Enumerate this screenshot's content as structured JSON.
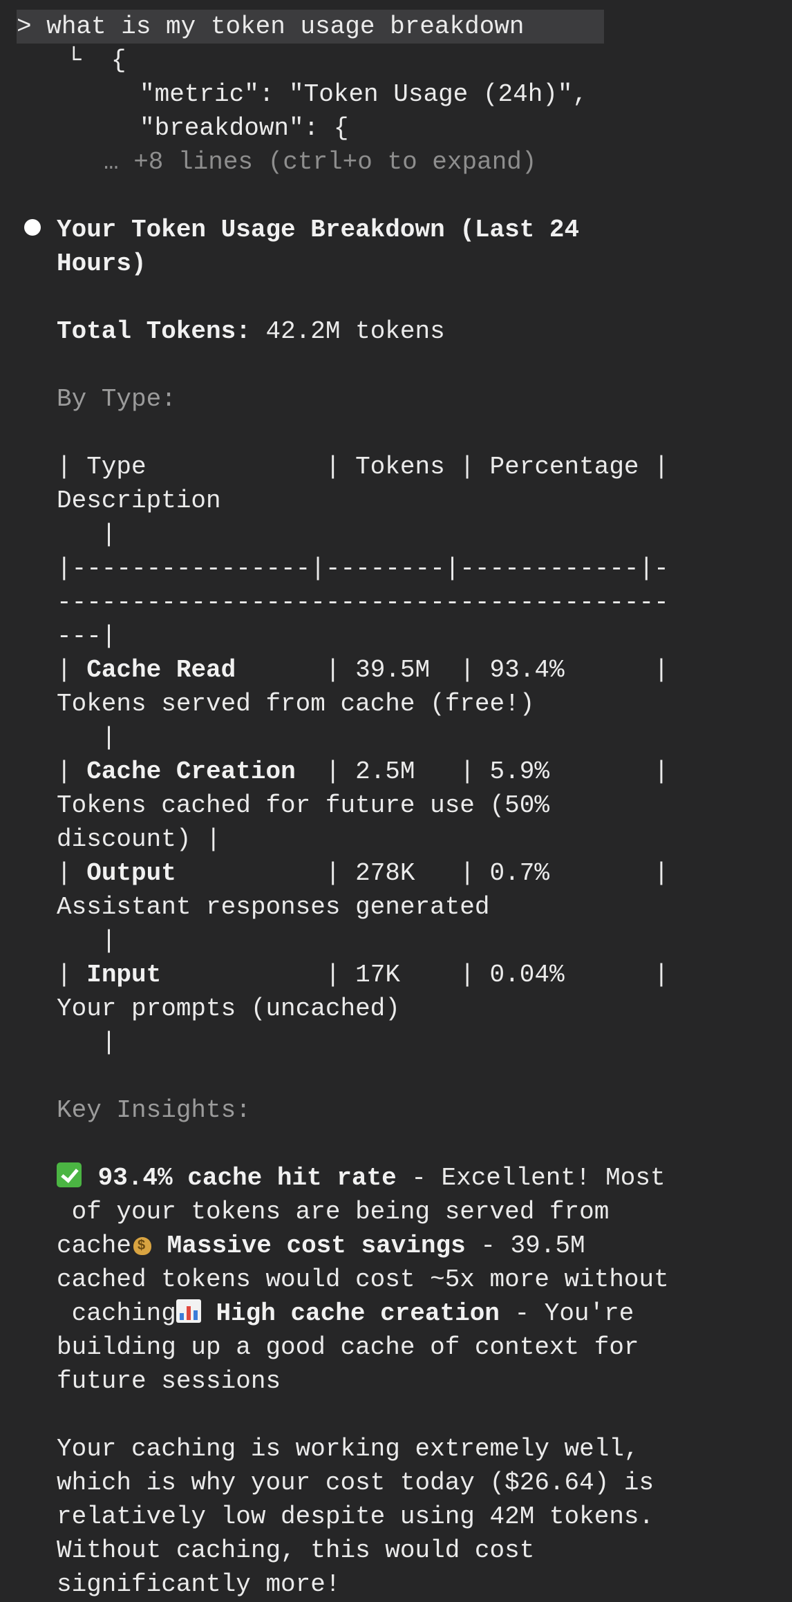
{
  "command": {
    "prompt_symbol": ">",
    "text": "what is my token usage breakdown"
  },
  "tool_output": {
    "corner": "└",
    "lines": [
      "{",
      "\"metric\": \"Token Usage (24h)\",",
      "\"breakdown\": {"
    ],
    "collapsed": "… +8 lines (ctrl+o to expand)"
  },
  "response": {
    "heading_line1": "Your Token Usage Breakdown (Last 24",
    "heading_line2": "Hours)",
    "total_label": "Total Tokens:",
    "total_value": " 42.2M tokens",
    "by_type_label": "By Type:",
    "table": {
      "header_line1": "| Type            | Tokens | Percentage |",
      "header_line2": "Description",
      "header_line3": "   |",
      "sep_line1": "|----------------|--------|------------|-",
      "sep_line2": "-----------------------------------------",
      "sep_line3": "---|",
      "rows": [
        {
          "name": "Cache Read",
          "pad": "     ",
          "rest": " | 39.5M  | 93.4%      |",
          "desc_lines": [
            "Tokens served from cache (free!)",
            "   |"
          ]
        },
        {
          "name": "Cache Creation",
          "pad": " ",
          "rest": " | 2.5M   | 5.9%       |",
          "desc_lines": [
            "Tokens cached for future use (50%",
            "discount) |"
          ]
        },
        {
          "name": "Output",
          "pad": "         ",
          "rest": " | 278K   | 0.7%       |",
          "desc_lines": [
            "Assistant responses generated",
            "   |"
          ]
        },
        {
          "name": "Input",
          "pad": "          ",
          "rest": " | 17K    | 0.04%      |",
          "desc_lines": [
            "Your prompts (uncached)",
            "   |"
          ]
        }
      ]
    },
    "insights_label": "Key Insights:",
    "insights": {
      "l1_bold": "93.4% cache hit rate",
      "l1_rest": " - Excellent! Most",
      "l2": " of your tokens are being served from",
      "l3_pre": "cache",
      "l3_bold": "Massive cost savings",
      "l3_rest": " - 39.5M",
      "l4": "cached tokens would cost ~5x more without",
      "l5_pre": " caching",
      "l5_bold": "High cache creation",
      "l5_rest": " - You're",
      "l6": "building up a good cache of context for",
      "l7": "future sessions"
    },
    "summary_lines": [
      "Your caching is working extremely well,",
      "which is why your cost today ($26.64) is",
      "relatively low despite using 42M tokens.",
      "Without caching, this would cost",
      "significantly more!"
    ]
  },
  "icons": {
    "check": "check-mark-icon",
    "money": "money-bag-icon",
    "chart": "bar-chart-icon"
  },
  "colors": {
    "background": "#262627",
    "text": "#ebebeb",
    "dim": "#8e8e8e",
    "prompt_highlight": "#3c3c3e",
    "check_green": "#4bb543"
  }
}
